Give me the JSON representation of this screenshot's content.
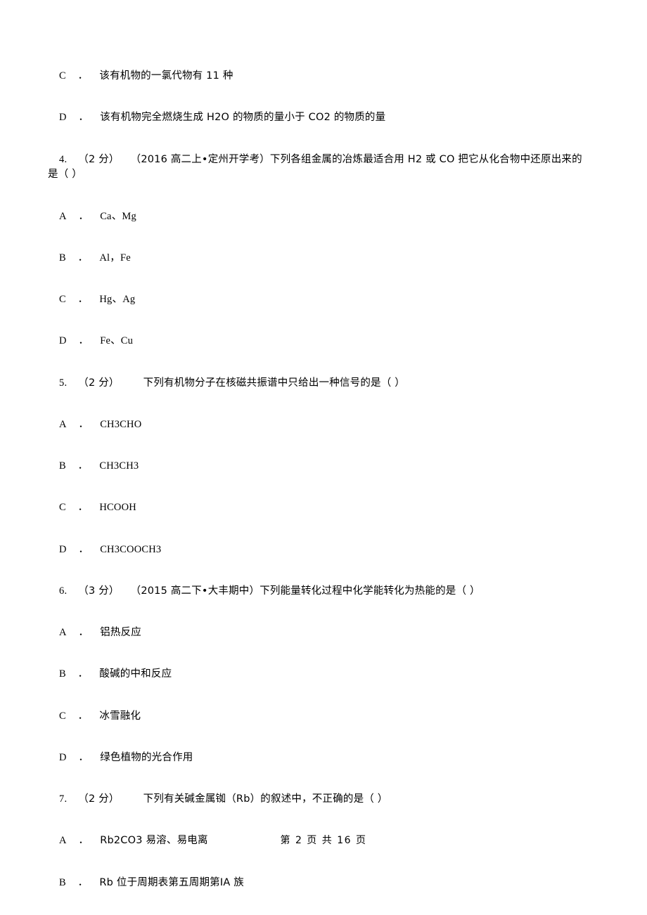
{
  "document": {
    "page_footer": "第 2 页 共 16 页",
    "blocks": [
      {
        "type": "option",
        "letter": "C",
        "text": "该有机物的一氯代物有 11 种"
      },
      {
        "type": "option",
        "letter": "D",
        "text": "该有机物完全燃烧生成 H2O 的物质的量小于 CO2 的物质的量"
      },
      {
        "type": "question",
        "number": "4.",
        "score": "（2 分）",
        "source": "（2016 高二上•定州开学考）",
        "text": "下列各组金属的冶炼最适合用 H2 或 CO 把它从化合物中还原出来的",
        "text2": "是（        ）"
      },
      {
        "type": "option",
        "letter": "A",
        "text": "Ca、Mg"
      },
      {
        "type": "option",
        "letter": "B",
        "text": "Al，Fe"
      },
      {
        "type": "option",
        "letter": "C",
        "text": "Hg、Ag"
      },
      {
        "type": "option",
        "letter": "D",
        "text": "Fe、Cu"
      },
      {
        "type": "question",
        "number": "5.",
        "score": "（2 分）",
        "source": "",
        "text": "下列有机物分子在核磁共振谱中只给出一种信号的是（        ）",
        "text2": ""
      },
      {
        "type": "option",
        "letter": "A",
        "text": "CH3CHO"
      },
      {
        "type": "option",
        "letter": "B",
        "text": "CH3CH3"
      },
      {
        "type": "option",
        "letter": "C",
        "text": "HCOOH"
      },
      {
        "type": "option",
        "letter": "D",
        "text": "CH3COOCH3"
      },
      {
        "type": "question",
        "number": "6.",
        "score": "（3 分）",
        "source": "（2015 高二下•大丰期中）",
        "text": "下列能量转化过程中化学能转化为热能的是（        ）",
        "text2": ""
      },
      {
        "type": "option",
        "letter": "A",
        "text": "铝热反应"
      },
      {
        "type": "option",
        "letter": "B",
        "text": "酸碱的中和反应"
      },
      {
        "type": "option",
        "letter": "C",
        "text": "冰雪融化"
      },
      {
        "type": "option",
        "letter": "D",
        "text": "绿色植物的光合作用"
      },
      {
        "type": "question",
        "number": "7.",
        "score": "（2 分）",
        "source": "",
        "text": "下列有关碱金属铷（Rb）的叙述中，不正确的是（        ）",
        "text2": ""
      },
      {
        "type": "option",
        "letter": "A",
        "text": "Rb2CO3 易溶、易电离"
      },
      {
        "type": "option",
        "letter": "B",
        "text": "Rb 位于周期表第五周期第ⅠA 族"
      }
    ]
  }
}
